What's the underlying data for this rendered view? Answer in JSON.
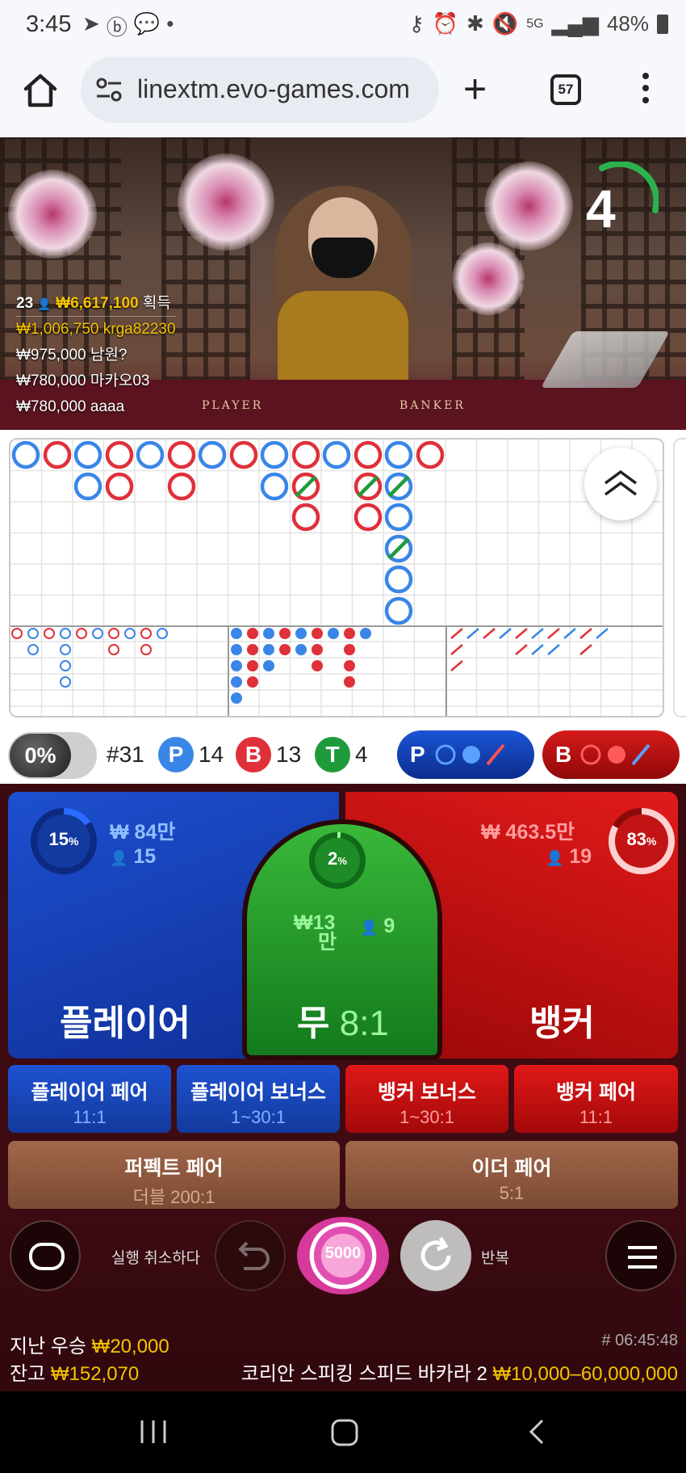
{
  "status_bar": {
    "time": "3:45",
    "battery": "48%",
    "network": "5G"
  },
  "browser": {
    "url": "linextm.evo-games.com",
    "tab_count": "57"
  },
  "video": {
    "countdown": "4",
    "table_labels": [
      "PLAYER",
      "BANKER"
    ],
    "winners_header": {
      "count": "23",
      "total": "₩6,617,100",
      "suffix": "획득"
    },
    "winners": [
      {
        "amount": "₩1,006,750",
        "name": "krga82230"
      },
      {
        "amount": "₩975,000",
        "name": "남원?"
      },
      {
        "amount": "₩780,000",
        "name": "마카오03"
      },
      {
        "amount": "₩780,000",
        "name": "aaaa"
      }
    ]
  },
  "stats": {
    "percent_toggle": "0%",
    "round": "#31",
    "player_label": "P",
    "player_count": "14",
    "banker_label": "B",
    "banker_count": "13",
    "tie_label": "T",
    "tie_count": "4",
    "player_predict_label": "P",
    "banker_predict_label": "B"
  },
  "bets": {
    "player": {
      "label": "플레이어",
      "percent": "15",
      "amount": "₩ 84만",
      "bettors": "15"
    },
    "tie": {
      "label": "무",
      "odds": "8:1",
      "percent": "2",
      "amount_top": "₩13",
      "amount_bottom": "만",
      "bettors": "9"
    },
    "banker": {
      "label": "뱅커",
      "percent": "83",
      "amount": "₩ 463.5만",
      "bettors": "19"
    },
    "side": [
      {
        "title": "플레이어 페어",
        "odds": "11:1"
      },
      {
        "title": "플레이어 보너스",
        "odds": "1~30:1"
      },
      {
        "title": "뱅커 보너스",
        "odds": "1~30:1"
      },
      {
        "title": "뱅커 페어",
        "odds": "11:1"
      }
    ],
    "perfect_pair": {
      "title": "퍼펙트 페어",
      "odds": "더블 200:1"
    },
    "either_pair": {
      "title": "이더 페어",
      "odds": "5:1"
    }
  },
  "controls": {
    "undo_label": "실행 취소하다",
    "chip_value": "5000",
    "repeat_label": "반복"
  },
  "info": {
    "last_win_label": "지난 우승",
    "last_win_value": "₩20,000",
    "balance_label": "잔고",
    "balance_value": "₩152,070",
    "game_id": "# 06:45:48",
    "table_name": "코리안 스피킹 스피드 바카라 2",
    "limits": "₩10,000–60,000,000"
  },
  "colors": {
    "player_blue": "#1d4fd0",
    "banker_red": "#e11a1a",
    "tie_green": "#2aa32f",
    "gold": "#f5c400"
  }
}
